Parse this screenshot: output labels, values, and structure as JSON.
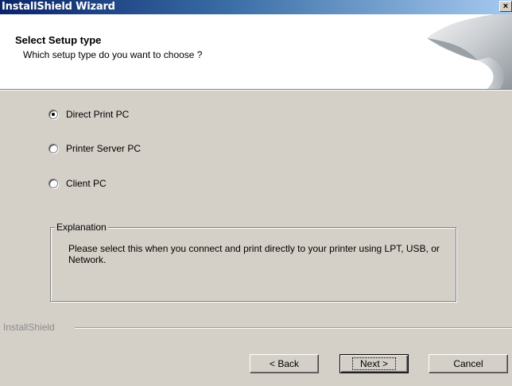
{
  "window": {
    "title": "InstallShield Wizard",
    "close_glyph": "×"
  },
  "header": {
    "title": "Select Setup type",
    "subtitle": "Which setup type do you want to choose ?"
  },
  "options": [
    {
      "label": "Direct Print PC",
      "checked": true
    },
    {
      "label": "Printer Server PC",
      "checked": false
    },
    {
      "label": "Client PC",
      "checked": false
    }
  ],
  "explanation": {
    "legend": "Explanation",
    "text": "Please select this when you connect and print directly to your printer using LPT, USB, or Network."
  },
  "footer": {
    "brand": "InstallShield"
  },
  "buttons": {
    "back": "< Back",
    "next": "Next >",
    "cancel": "Cancel"
  }
}
